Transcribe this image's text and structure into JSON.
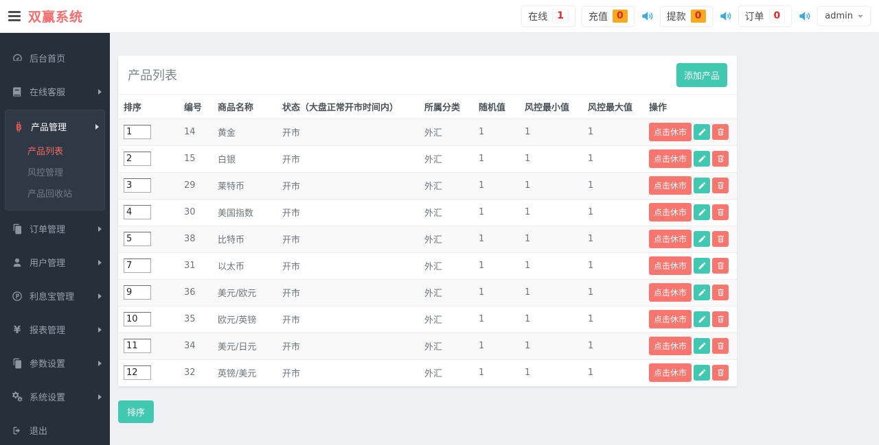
{
  "header": {
    "brand": "双赢系统",
    "stats": [
      {
        "label": "在线",
        "value": "1",
        "badge": "plain"
      },
      {
        "label": "充值",
        "value": "0",
        "badge": "orange"
      },
      {
        "label": "提款",
        "value": "0",
        "badge": "orange"
      },
      {
        "label": "订单",
        "value": "0",
        "badge": "plain"
      }
    ],
    "user_menu": {
      "label": "admin"
    }
  },
  "sidebar": {
    "items": [
      {
        "label": "后台首页",
        "icon": "dashboard-icon"
      },
      {
        "label": "在线客服",
        "icon": "book-icon",
        "arrow": true
      },
      {
        "label": "产品管理",
        "icon": "bitcoin-icon",
        "arrow": true,
        "active": true,
        "children": [
          {
            "label": "产品列表",
            "active": true
          },
          {
            "label": "风控管理",
            "active": false
          },
          {
            "label": "产品回收站",
            "active": false
          }
        ]
      },
      {
        "label": "订单管理",
        "icon": "files-icon",
        "arrow": true
      },
      {
        "label": "用户管理",
        "icon": "user-icon",
        "arrow": true
      },
      {
        "label": "利息宝管理",
        "icon": "p-circle-icon",
        "arrow": true
      },
      {
        "label": "报表管理",
        "icon": "yen-icon",
        "arrow": true
      },
      {
        "label": "参数设置",
        "icon": "files-icon",
        "arrow": true
      },
      {
        "label": "系统设置",
        "icon": "gears-icon",
        "arrow": true
      },
      {
        "label": "退出",
        "icon": "signout-icon"
      }
    ]
  },
  "main": {
    "card_title": "产品列表",
    "add_button": "添加产品",
    "sort_button": "排序",
    "table": {
      "headers": [
        "排序",
        "编号",
        "商品名称",
        "状态（大盘正常开市时间内）",
        "所属分类",
        "随机值",
        "风控最小值",
        "风控最大值",
        "操作"
      ],
      "action_close": "点击休市",
      "rows": [
        {
          "sort": "1",
          "id": "14",
          "name": "黄金",
          "status": "开市",
          "category": "外汇",
          "random": "1",
          "min": "1",
          "max": "1"
        },
        {
          "sort": "2",
          "id": "15",
          "name": "白银",
          "status": "开市",
          "category": "外汇",
          "random": "1",
          "min": "1",
          "max": "1"
        },
        {
          "sort": "3",
          "id": "29",
          "name": "莱特币",
          "status": "开市",
          "category": "外汇",
          "random": "1",
          "min": "1",
          "max": "1"
        },
        {
          "sort": "4",
          "id": "30",
          "name": "美国指数",
          "status": "开市",
          "category": "外汇",
          "random": "1",
          "min": "1",
          "max": "1"
        },
        {
          "sort": "5",
          "id": "38",
          "name": "比特币",
          "status": "开市",
          "category": "外汇",
          "random": "1",
          "min": "1",
          "max": "1"
        },
        {
          "sort": "7",
          "id": "31",
          "name": "以太币",
          "status": "开市",
          "category": "外汇",
          "random": "1",
          "min": "1",
          "max": "1"
        },
        {
          "sort": "9",
          "id": "36",
          "name": "美元/欧元",
          "status": "开市",
          "category": "外汇",
          "random": "1",
          "min": "1",
          "max": "1"
        },
        {
          "sort": "10",
          "id": "35",
          "name": "欧元/英镑",
          "status": "开市",
          "category": "外汇",
          "random": "1",
          "min": "1",
          "max": "1"
        },
        {
          "sort": "11",
          "id": "34",
          "name": "美元/日元",
          "status": "开市",
          "category": "外汇",
          "random": "1",
          "min": "1",
          "max": "1"
        },
        {
          "sort": "12",
          "id": "32",
          "name": "英镑/美元",
          "status": "开市",
          "category": "外汇",
          "random": "1",
          "min": "1",
          "max": "1"
        }
      ]
    }
  },
  "colors": {
    "brand_red": "#f56e6e",
    "teal_accent": "#41c8b1",
    "salmon_button": "#f8766d",
    "badge_orange": "#f9a91e",
    "badge_number_red": "#e8252a",
    "speaker_blue": "#3aa9dc",
    "sidebar_bg": "#262f3a",
    "sidebar_active_panel": "#2e3945",
    "active_submenu_red": "#f5695c",
    "content_bg": "#eef0f4"
  }
}
